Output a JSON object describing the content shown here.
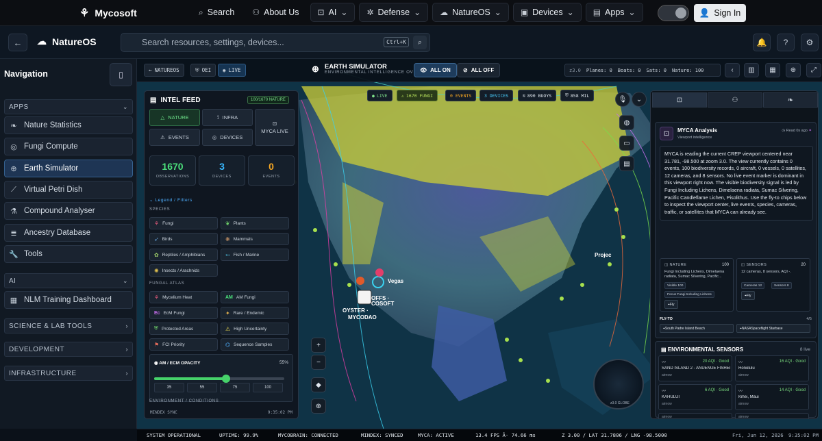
{
  "topbar": {
    "brand": "Mycosoft",
    "nav": [
      {
        "label": "Search",
        "icon": "search-icon",
        "box": false
      },
      {
        "label": "About Us",
        "icon": "users-icon",
        "box": false
      },
      {
        "label": "AI",
        "icon": "robot-icon",
        "box": true
      },
      {
        "label": "Defense",
        "icon": "shield-icon",
        "box": true
      },
      {
        "label": "NatureOS",
        "icon": "cloud-icon",
        "box": true
      },
      {
        "label": "Devices",
        "icon": "chip-icon",
        "box": true
      },
      {
        "label": "Apps",
        "icon": "apps-icon",
        "box": true
      }
    ],
    "signin": "Sign In"
  },
  "subbar": {
    "title": "NatureOS",
    "search_placeholder": "Search resources, settings, devices...",
    "kbd": "Ctrl+K"
  },
  "sidebar": {
    "title": "Navigation",
    "groups": [
      {
        "label": "APPS"
      },
      {
        "label": "AI"
      },
      {
        "label": "SCIENCE & LAB TOOLS"
      },
      {
        "label": "DEVELOPMENT"
      },
      {
        "label": "INFRASTRUCTURE"
      }
    ],
    "items": [
      "Nature Statistics",
      "Fungi Compute",
      "Earth Simulator",
      "Virtual Petri Dish",
      "Compound Analyser",
      "Ancestry Database",
      "Tools",
      "NLM Training Dashboard"
    ]
  },
  "maptool": {
    "chips": [
      "NATUREOS",
      "OEI",
      "LIVE"
    ],
    "title": "EARTH SIMULATOR",
    "subtitle": "ENVIRONMENTAL INTELLIGENCE OVERLAY",
    "all_on": "ALL ON",
    "all_off": "ALL OFF",
    "stats": {
      "zoom": "z3.0",
      "planes": "Planes: 0",
      "boats": "Boats: 0",
      "sats": "Sats: 0",
      "nature": "Nature: 100"
    }
  },
  "intel": {
    "title": "INTEL FEED",
    "badge": "100/1670 NATURE",
    "tabs": [
      "NATURE",
      "INFRA",
      "EVENTS",
      "DEVICES",
      "MYCA LIVE"
    ],
    "stats": [
      {
        "n": "1670",
        "l": "OBSERVATIONS",
        "c": "#4be07b"
      },
      {
        "n": "3",
        "l": "DEVICES",
        "c": "#38b8ff"
      },
      {
        "n": "0",
        "l": "EVENTS",
        "c": "#f5a623"
      }
    ],
    "legend_link": "Legend / Filters",
    "species_head": "SPECIES",
    "species": [
      "Fungi",
      "Plants",
      "Birds",
      "Mammals",
      "Reptiles / Amphibians",
      "Fish / Marine",
      "Insects / Arachnids"
    ],
    "atlas_head": "FUNGAL ATLAS",
    "atlas": [
      "Mycelium Heat",
      "AM Fungi",
      "EcM Fungi",
      "Rare / Endemic",
      "Protected Areas",
      "High Uncertainty",
      "FCI Priority",
      "Sequence Samples"
    ],
    "opacity_label": "AM / ECM OPACITY",
    "opacity_value": "55%",
    "opacity_fraction": 0.55,
    "presets": [
      "35",
      "55",
      "75",
      "100"
    ],
    "env_head": "ENVIRONMENT / CONDITIONS",
    "foot": "MINDEX SYNC",
    "foot_time": "9:35:02 PM"
  },
  "mapchips": [
    "LIVE",
    "1670 FUNGI",
    "0 EVENTS",
    "3 DEVICES",
    "890 BUOYS",
    "858 MIL"
  ],
  "map_labels": {
    "vegas": "Vegas",
    "oyster": "OYSTER ·",
    "mycodao": "MYCODAO",
    "offs": "OFFS ·",
    "cosoft": "COSOFT",
    "proj": "Projec"
  },
  "myca": {
    "title": "MYCA Analysis",
    "sub": "Viewport intelligence",
    "read": "Read 0s ago",
    "text": "MYCA is reading the current CREP viewport centered near 31.781, -98.500 at zoom 3.0. The view currently contains 0 events, 100 biodiversity records, 0 aircraft, 0 vessels, 0 satellites, 12 cameras, and 8 sensors. No live event marker is dominant in this viewport right now. The visible biodiversity signal is led by Fungi Including Lichens, Dimelaena radiata, Sumac Silvering, Pacific Candleflame Lichen, Pisolithus. Use the fly-to chips below to inspect the viewport center, live events, species, cameras, traffic, or satellites that MYCA can already see.",
    "nature": {
      "h": "NATURE",
      "c": "100",
      "b": "Fungi Including Lichens, Dimelaena radiata, Sumac Silvering, Pacific...",
      "t1": "Visible 100",
      "t2": "Focus Fungi Including Lichens",
      "fly": "Fly"
    },
    "sensors": {
      "h": "SENSORS",
      "c": "20",
      "b": "12 cameras, 8 sensors, AQI -.",
      "t1": "Cameras 12",
      "t2": "Sensors 8",
      "fly": "Fly"
    },
    "flyto": "FLY-TO",
    "flyto_count": "4/5",
    "fly1": "South Padre Island Beach",
    "fly2": "NASASpaceflight Starbase"
  },
  "env": {
    "title": "ENVIRONMENTAL SENSORS",
    "count": "8 live",
    "sensors": [
      {
        "q": "20 AQI · Good",
        "n": "SAND ISLAND 2 - ANUENUE FISHER...",
        "s": "airnow"
      },
      {
        "q": "16 AQI · Good",
        "n": "Honolulu",
        "s": "airnow"
      },
      {
        "q": "6 AQI · Good",
        "n": "KAHULUI",
        "s": "airnow"
      },
      {
        "q": "14 AQI · Good",
        "n": "Kihei, Maui",
        "s": "airnow"
      },
      {
        "q": "",
        "n": "",
        "s": "airnow"
      },
      {
        "q": "",
        "n": "",
        "s": "airnow"
      }
    ]
  },
  "globe": "z3.0 GLOBE",
  "status": {
    "sys": "SYSTEM OPERATIONAL",
    "up": "UPTIME: 99.9%",
    "brain": "MYCOBRAIN: CONNECTED",
    "mindex": "MINDEX: SYNCED",
    "myca": "MYCA: ACTIVE",
    "fps": "13.4 FPS Â· 74.66 ms",
    "coords": "Z 3.00 / LAT 31.7806 / LNG -98.5000",
    "date": "Fri, Jun 12, 2026",
    "time": "9:35:02 PM"
  }
}
